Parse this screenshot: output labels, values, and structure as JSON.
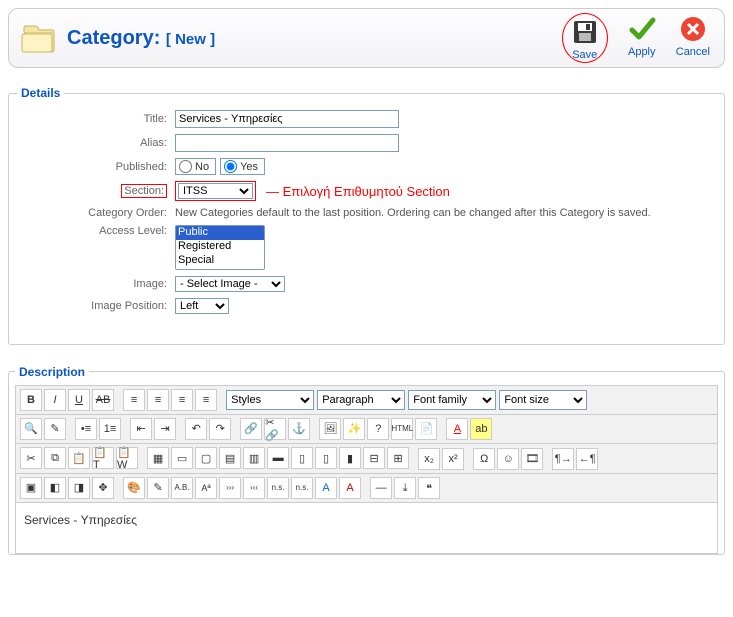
{
  "header": {
    "title_prefix": "Category:",
    "title_state": "[ New ]"
  },
  "toolbar": {
    "save": "Save",
    "apply": "Apply",
    "cancel": "Cancel"
  },
  "details": {
    "legend": "Details",
    "labels": {
      "title": "Title:",
      "alias": "Alias:",
      "published": "Published:",
      "section": "Section:",
      "category_order": "Category Order:",
      "access_level": "Access Level:",
      "image": "Image:",
      "image_position": "Image Position:"
    },
    "values": {
      "title": "Services - Υπηρεσίες",
      "alias": "",
      "published_no": "No",
      "published_yes": "Yes",
      "section_selected": "ITSS",
      "section_annotation": "Επιλογή Επιθυμητού Section",
      "category_order_note": "New Categories default to the last position. Ordering can be changed after this Category is saved.",
      "access_levels": [
        "Public",
        "Registered",
        "Special"
      ],
      "image_selected": "- Select Image -",
      "image_position_selected": "Left"
    }
  },
  "description": {
    "legend": "Description",
    "style_sel": "Styles",
    "format_sel": "Paragraph",
    "fontfam_sel": "Font family",
    "fontsize_sel": "Font size",
    "body_text": "Services - Υπηρεσίες"
  }
}
